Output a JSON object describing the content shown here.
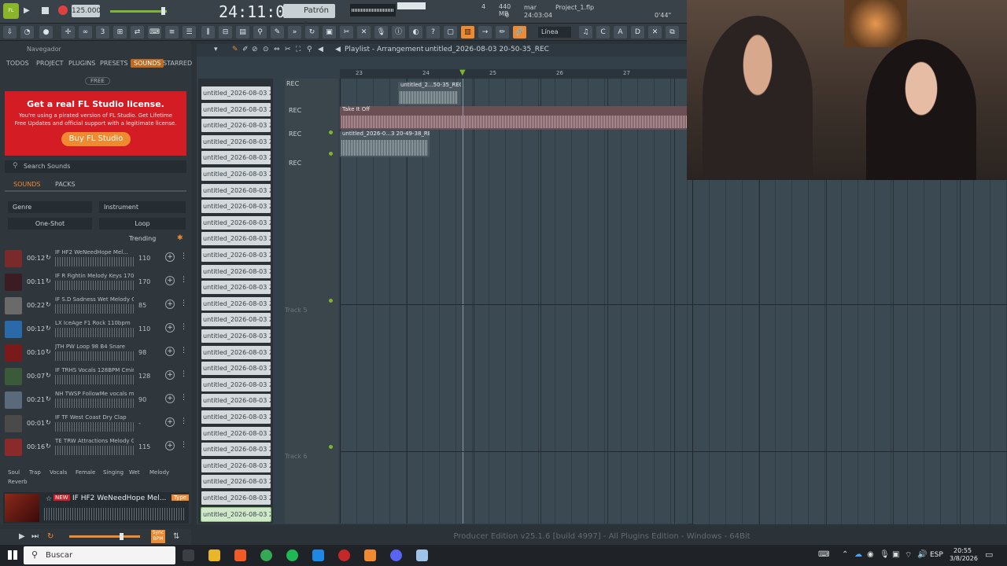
{
  "toolbar": {
    "bpm": "125.000",
    "time": "24:11:01",
    "pattern": "Patrón 1",
    "cpu_value": "4",
    "ram": "440 MB",
    "poly": "0",
    "hint_label": "mar",
    "hint_time": "24:03:04",
    "project_name": "Project_1.flp",
    "length": "0'44\"",
    "snap": "Línea"
  },
  "browser": {
    "header": "Navegador",
    "tabs": [
      "TODOS",
      "PROJECT",
      "PLUGINS",
      "PRESETS",
      "SOUNDS",
      "STARRED"
    ],
    "free_label": "FREE",
    "ad_title": "Get a real FL Studio license.",
    "ad_text": "You're using a pirated version of FL Studio. Get Lifetime Free Updates and official support with a legitimate license.",
    "ad_button": "Buy FL Studio",
    "search_placeholder": "Search Sounds",
    "sub_tabs": [
      "SOUNDS",
      "PACKS"
    ],
    "filter_genre": "Genre",
    "filter_instrument": "Instrument",
    "filter_oneshot": "One-Shot",
    "filter_loop": "Loop",
    "sort": "Trending",
    "sounds": [
      {
        "dur": "00:12",
        "name": "IF HF2 WeNeedHope Mel...",
        "bpm": "110",
        "color": "#7a2a2a",
        "new": "NEW"
      },
      {
        "dur": "00:11",
        "name": "IF R Fightin Melody Keys 170BPM...",
        "bpm": "170",
        "color": "#3a1c22",
        "new": ""
      },
      {
        "dur": "00:22",
        "name": "IF S.D Sadness Wet Melody Guitar...",
        "bpm": "85",
        "color": "#6a6a6a",
        "new": ""
      },
      {
        "dur": "00:12",
        "name": "LX IceAge F1 Rock 110bpm",
        "bpm": "110",
        "color": "#2b6aa8",
        "new": ""
      },
      {
        "dur": "00:10",
        "name": "JTH PW Loop 98 B4 Snare",
        "bpm": "98",
        "color": "#7a1a1a",
        "new": ""
      },
      {
        "dur": "00:07",
        "name": "IF TRHS Vocals 128BPM Cmin",
        "bpm": "128",
        "color": "#3a5a3a",
        "new": ""
      },
      {
        "dur": "00:21",
        "name": "NH TWSP FollowMe vocals melody...",
        "bpm": "90",
        "color": "#5a6a7a",
        "new": ""
      },
      {
        "dur": "00:01",
        "name": "IF TF West Coast Dry Clap",
        "bpm": "-",
        "color": "#4a4a4a",
        "new": ""
      },
      {
        "dur": "00:16",
        "name": "TE TRW Attractions Melody Guitar...",
        "bpm": "115",
        "color": "#8a2a2a",
        "new": ""
      }
    ],
    "tags": [
      "Soul",
      "Trap",
      "Vocals",
      "Female",
      "Singing",
      "Wet",
      "Melody",
      "Reverb"
    ],
    "preview_title": "IF HF2 WeNeedHope Mel...",
    "preview_new": "NEW",
    "preview_tag": "Type",
    "sync_label": "Sync BPM"
  },
  "playlist": {
    "title": "Playlist - Arrangement",
    "file": "untitled_2026-08-03 20-50-35_REC",
    "ruler": [
      "23",
      "24",
      "25",
      "26",
      "27"
    ],
    "tracks": [
      "REC",
      "REC",
      "REC",
      "REC",
      "Track 5",
      "Track 6"
    ],
    "clip1": "untitled_2...50-35_REC",
    "clip2": "Take It Off",
    "clip3": "untitled_2026-0...3 20-49-38_REC"
  },
  "clips": {
    "items": [
      "untitled_2026-08-03 20-...",
      "untitled_2026-08-03 20-...",
      "untitled_2026-08-03 20-...",
      "untitled_2026-08-03 20-...",
      "untitled_2026-08-03 20-...",
      "untitled_2026-08-03 20-...",
      "untitled_2026-08-03 20-...",
      "untitled_2026-08-03 20-...",
      "untitled_2026-08-03 20-...",
      "untitled_2026-08-03 20-...",
      "untitled_2026-08-03 20-...",
      "untitled_2026-08-03 20-...",
      "untitled_2026-08-03 20-...",
      "untitled_2026-08-03 20-...",
      "untitled_2026-08-03 20-...",
      "untitled_2026-08-03 20-...",
      "untitled_2026-08-03 20-...",
      "untitled_2026-08-03 20-...",
      "untitled_2026-08-03 20-...",
      "untitled_2026-08-03 20-...",
      "untitled_2026-08-03 20-...",
      "untitled_2026-08-03 20-...",
      "untitled_2026-08-03 20-...",
      "untitled_2026-08-03 20-...",
      "untitled_2026-08-03 20-...",
      "untitled_2026-08-03 20-...",
      "untitled_2026-08-03 20-..."
    ],
    "selected_index": 26
  },
  "status_bar": "Producer Edition v25.1.6 [build 4997] - All Plugins Edition - Windows - 64Bit",
  "taskbar": {
    "search": "Buscar",
    "lang": "ESP",
    "time": "20:55",
    "date": "3/8/2026"
  },
  "colors": {
    "accent": "#f08a30",
    "ad_red": "#d31c24",
    "clip_green": "#88b96a",
    "clip_pink": "#b88a8e"
  }
}
